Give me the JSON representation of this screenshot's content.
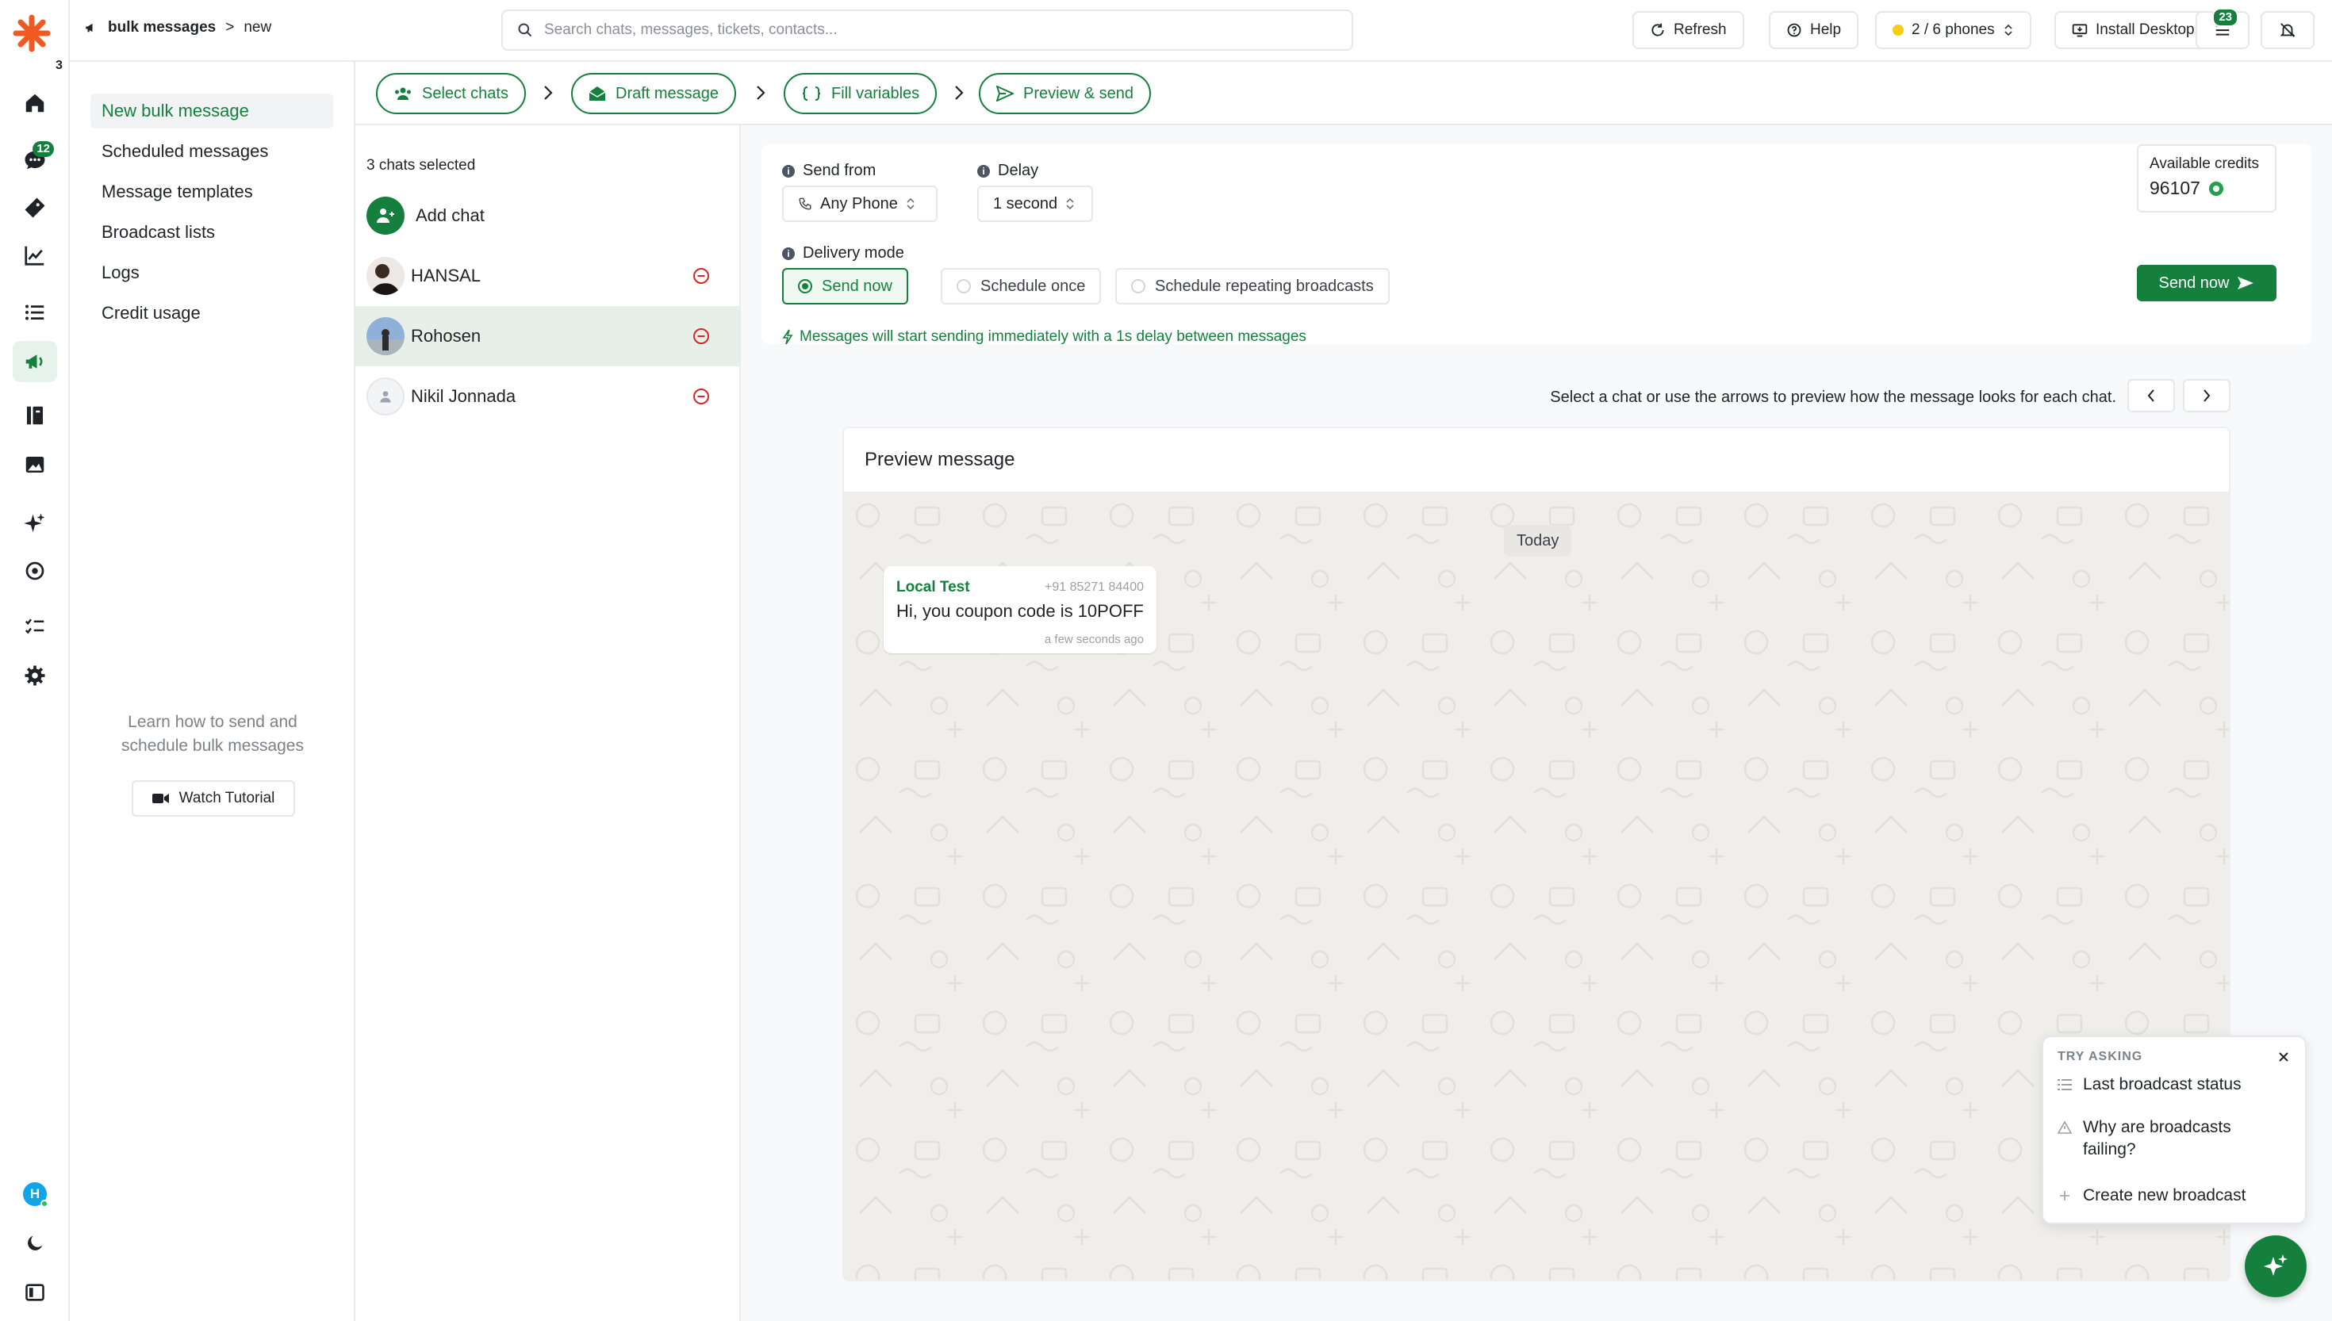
{
  "app": {
    "logo_badge": "3",
    "accent_color": "#15803d",
    "user_avatar_initial": "H"
  },
  "rail": {
    "items": [
      {
        "icon": "home-icon"
      },
      {
        "icon": "chat-icon",
        "badge": "12"
      },
      {
        "icon": "ticket-icon"
      },
      {
        "icon": "analytics-icon"
      },
      {
        "icon": "list-icon"
      },
      {
        "icon": "megaphone-icon",
        "active": true
      },
      {
        "icon": "contacts-book-icon"
      },
      {
        "icon": "media-icon"
      },
      {
        "icon": "sparkle-icon"
      },
      {
        "icon": "integrations-icon"
      },
      {
        "icon": "tasks-icon"
      },
      {
        "icon": "settings-icon"
      }
    ]
  },
  "topbar": {
    "breadcrumb": {
      "section": "bulk messages",
      "separator": ">",
      "page": "new"
    },
    "search_placeholder": "Search chats, messages, tickets, contacts...",
    "refresh_label": "Refresh",
    "help_label": "Help",
    "phones_label": "2 / 6 phones",
    "install_label": "Install Desktop App",
    "notifications_badge": "23"
  },
  "subnav": {
    "items": [
      {
        "label": "New bulk message",
        "active": true
      },
      {
        "label": "Scheduled messages"
      },
      {
        "label": "Message templates"
      },
      {
        "label": "Broadcast lists"
      },
      {
        "label": "Logs"
      },
      {
        "label": "Credit usage"
      }
    ],
    "learn_line1": "Learn how to send and",
    "learn_line2": "schedule bulk messages",
    "tutorial_label": "Watch Tutorial"
  },
  "stepper": {
    "steps": [
      {
        "label": "Select chats"
      },
      {
        "label": "Draft message"
      },
      {
        "label": "Fill variables"
      },
      {
        "label": "Preview & send"
      }
    ]
  },
  "chats": {
    "count_label": "3 chats selected",
    "add_label": "Add chat",
    "rows": [
      {
        "name": "HANSAL"
      },
      {
        "name": "Rohosen",
        "selected": true
      },
      {
        "name": "Nikil Jonnada"
      }
    ]
  },
  "settings": {
    "send_from_label": "Send from",
    "send_from_value": "Any Phone",
    "delay_label": "Delay",
    "delay_value": "1 second",
    "delivery_mode_label": "Delivery mode",
    "modes": [
      {
        "label": "Send now",
        "active": true
      },
      {
        "label": "Schedule once"
      },
      {
        "label": "Schedule repeating broadcasts"
      }
    ],
    "mode_hint": "Messages will start sending immediately with a 1s delay between messages",
    "credits_label": "Available credits",
    "credits_value": "96107",
    "send_button_label": "Send now"
  },
  "preview": {
    "hint": "Select a chat or use the arrows to preview how the message looks for each chat.",
    "title": "Preview message",
    "day_label": "Today",
    "message": {
      "sender": "Local Test",
      "phone": "+91 85271 84400",
      "text": "Hi, you coupon code is 10POFF",
      "time": "a few seconds ago"
    }
  },
  "ask": {
    "title": "TRY ASKING",
    "items": [
      {
        "label": "Last broadcast status",
        "icon": "list-icon"
      },
      {
        "label": "Why are broadcasts failing?",
        "icon": "warning-icon"
      },
      {
        "label": "Create new broadcast",
        "icon": "plus-icon"
      }
    ]
  }
}
